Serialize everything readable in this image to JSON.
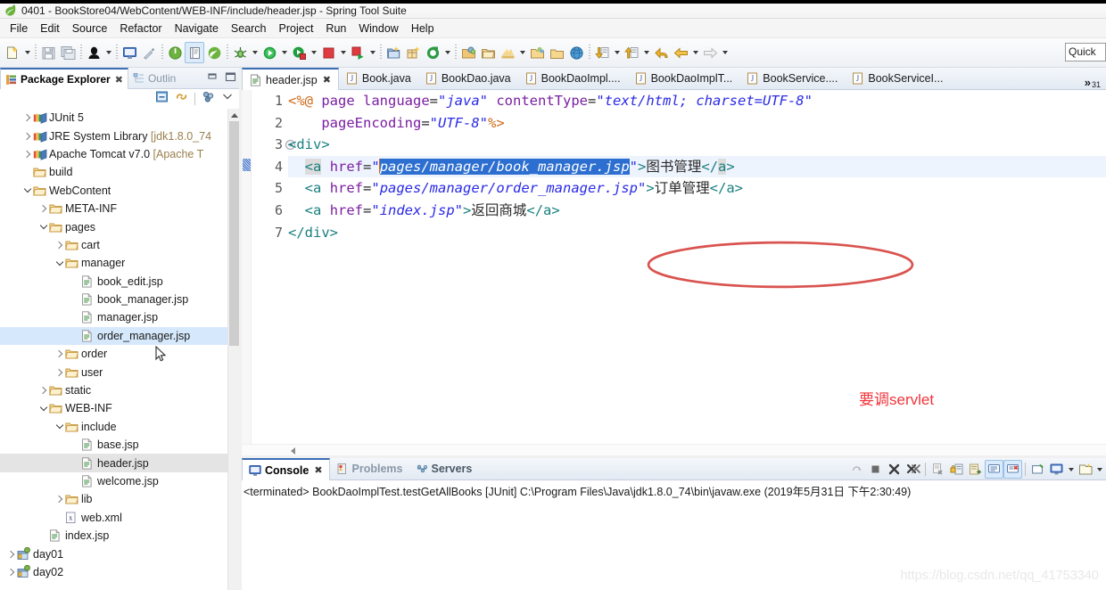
{
  "window": {
    "title": "0401 - BookStore04/WebContent/WEB-INF/include/header.jsp - Spring Tool Suite",
    "logo_icon": "spring-leaf-icon"
  },
  "menubar": {
    "items": [
      {
        "label": "File"
      },
      {
        "label": "Edit"
      },
      {
        "label": "Source"
      },
      {
        "label": "Refactor"
      },
      {
        "label": "Navigate"
      },
      {
        "label": "Search"
      },
      {
        "label": "Project"
      },
      {
        "label": "Run"
      },
      {
        "label": "Window"
      },
      {
        "label": "Help"
      }
    ]
  },
  "toolbar": {
    "quick_access_text": "Quick",
    "buttons": [
      {
        "name": "new-wizard-icon",
        "type": "icon"
      },
      {
        "name": "new-dropdown-arrow",
        "type": "arrow"
      },
      {
        "name": "separator-1",
        "type": "sep"
      },
      {
        "name": "save-icon",
        "type": "icon"
      },
      {
        "name": "save-all-icon",
        "type": "icon"
      },
      {
        "name": "separator-2",
        "type": "sep"
      },
      {
        "name": "print-icon",
        "type": "icon"
      },
      {
        "name": "print-dropdown-arrow",
        "type": "arrow"
      },
      {
        "name": "separator-3",
        "type": "sep"
      },
      {
        "name": "open-console-icon",
        "type": "icon"
      },
      {
        "name": "toggle-markoccurrences-icon",
        "type": "icon"
      },
      {
        "name": "separator-4",
        "type": "sep"
      },
      {
        "name": "boot-dashboard-icon",
        "type": "icon"
      },
      {
        "name": "new-spring-file-icon",
        "type": "icon"
      },
      {
        "name": "spring-leaf-icon",
        "type": "icon"
      },
      {
        "name": "separator-5",
        "type": "sep"
      },
      {
        "name": "debug-icon",
        "type": "icon"
      },
      {
        "name": "debug-dropdown-arrow",
        "type": "arrow"
      },
      {
        "name": "run-icon",
        "type": "icon"
      },
      {
        "name": "run-dropdown-arrow",
        "type": "arrow"
      },
      {
        "name": "run-external-icon",
        "type": "icon"
      },
      {
        "name": "run-external-dropdown-arrow",
        "type": "arrow"
      },
      {
        "name": "stop-icon",
        "type": "icon"
      },
      {
        "name": "stop-dropdown-arrow",
        "type": "arrow"
      },
      {
        "name": "run-server-icon",
        "type": "icon"
      },
      {
        "name": "run-server-dropdown-arrow",
        "type": "arrow"
      },
      {
        "name": "separator-6",
        "type": "sep"
      },
      {
        "name": "new-java-project-icon",
        "type": "icon"
      },
      {
        "name": "new-package-icon",
        "type": "icon"
      },
      {
        "name": "new-class-icon",
        "type": "icon"
      },
      {
        "name": "new-class-dropdown-arrow",
        "type": "arrow"
      },
      {
        "name": "separator-7",
        "type": "sep"
      },
      {
        "name": "open-type-icon",
        "type": "icon"
      },
      {
        "name": "open-task-icon",
        "type": "icon"
      },
      {
        "name": "search-web-icon",
        "type": "icon"
      },
      {
        "name": "search-dropdown-arrow",
        "type": "arrow"
      },
      {
        "name": "open-resource-icon",
        "type": "icon"
      },
      {
        "name": "browser-icon",
        "type": "icon"
      },
      {
        "name": "separator-8",
        "type": "sep"
      },
      {
        "name": "next-annotation-icon",
        "type": "icon"
      },
      {
        "name": "next-annotation-dropdown-arrow",
        "type": "arrow"
      },
      {
        "name": "previous-annotation-icon",
        "type": "icon"
      },
      {
        "name": "previous-annotation-dropdown-arrow",
        "type": "arrow"
      },
      {
        "name": "last-edit-location-icon",
        "type": "icon"
      },
      {
        "name": "back-icon",
        "type": "icon"
      },
      {
        "name": "back-dropdown-arrow",
        "type": "arrow"
      },
      {
        "name": "forward-icon",
        "type": "icon"
      },
      {
        "name": "forward-dropdown-arrow",
        "type": "arrow"
      }
    ]
  },
  "explorer": {
    "tabs": [
      {
        "label": "Package Explorer",
        "active": true,
        "icon": "package-explorer-icon"
      },
      {
        "label": "Outlin",
        "active": false,
        "icon": "outline-icon"
      }
    ],
    "view_controls": [
      "minimize-icon",
      "maximize-icon"
    ],
    "toolbar_icons": [
      "collapse-all-icon",
      "link-with-editor-icon",
      "view-menu-filter-icon",
      "view-menu-icon"
    ],
    "tree": [
      {
        "label": "JUnit 5",
        "icon": "library-icon",
        "indent": 1,
        "twisty": "right",
        "state": "normal"
      },
      {
        "label": "JRE System Library ",
        "dim": "[jdk1.8.0_74",
        "icon": "library-icon",
        "indent": 1,
        "twisty": "right",
        "state": "normal"
      },
      {
        "label": "Apache Tomcat v7.0 ",
        "dim": "[Apache T",
        "icon": "library-icon",
        "indent": 1,
        "twisty": "right",
        "state": "normal"
      },
      {
        "label": "build",
        "icon": "folder-icon",
        "indent": 1,
        "twisty": "none",
        "state": "normal"
      },
      {
        "label": "WebContent",
        "icon": "folder-icon",
        "indent": 1,
        "twisty": "down",
        "state": "normal"
      },
      {
        "label": "META-INF",
        "icon": "folder-icon",
        "indent": 2,
        "twisty": "right",
        "state": "normal"
      },
      {
        "label": "pages",
        "icon": "folder-icon",
        "indent": 2,
        "twisty": "down",
        "state": "normal"
      },
      {
        "label": "cart",
        "icon": "folder-icon",
        "indent": 3,
        "twisty": "right",
        "state": "normal"
      },
      {
        "label": "manager",
        "icon": "folder-icon",
        "indent": 3,
        "twisty": "down",
        "state": "normal"
      },
      {
        "label": "book_edit.jsp",
        "icon": "jsp-file-icon",
        "indent": 4,
        "twisty": "none",
        "state": "normal"
      },
      {
        "label": "book_manager.jsp",
        "icon": "jsp-file-icon",
        "indent": 4,
        "twisty": "none",
        "state": "normal"
      },
      {
        "label": "manager.jsp",
        "icon": "jsp-file-icon",
        "indent": 4,
        "twisty": "none",
        "state": "normal"
      },
      {
        "label": "order_manager.jsp",
        "icon": "jsp-file-icon",
        "indent": 4,
        "twisty": "none",
        "state": "selected-blue"
      },
      {
        "label": "order",
        "icon": "folder-icon",
        "indent": 3,
        "twisty": "right",
        "state": "normal"
      },
      {
        "label": "user",
        "icon": "folder-icon",
        "indent": 3,
        "twisty": "right",
        "state": "normal"
      },
      {
        "label": "static",
        "icon": "folder-icon",
        "indent": 2,
        "twisty": "right",
        "state": "normal"
      },
      {
        "label": "WEB-INF",
        "icon": "folder-icon",
        "indent": 2,
        "twisty": "down",
        "state": "normal"
      },
      {
        "label": "include",
        "icon": "folder-icon",
        "indent": 3,
        "twisty": "down",
        "state": "normal"
      },
      {
        "label": "base.jsp",
        "icon": "jsp-file-icon",
        "indent": 4,
        "twisty": "none",
        "state": "normal"
      },
      {
        "label": "header.jsp",
        "icon": "jsp-file-icon",
        "indent": 4,
        "twisty": "none",
        "state": "selected-gray"
      },
      {
        "label": "welcome.jsp",
        "icon": "jsp-file-icon",
        "indent": 4,
        "twisty": "none",
        "state": "normal"
      },
      {
        "label": "lib",
        "icon": "folder-icon",
        "indent": 3,
        "twisty": "right",
        "state": "normal"
      },
      {
        "label": "web.xml",
        "icon": "xml-file-icon",
        "indent": 3,
        "twisty": "none",
        "state": "normal"
      },
      {
        "label": "index.jsp",
        "icon": "jsp-file-icon",
        "indent": 2,
        "twisty": "none",
        "state": "normal"
      },
      {
        "label": "day01",
        "icon": "web-project-icon",
        "indent": 0,
        "twisty": "right",
        "state": "normal"
      },
      {
        "label": "day02",
        "icon": "web-project-icon",
        "indent": 0,
        "twisty": "right",
        "state": "normal"
      }
    ]
  },
  "editor": {
    "tabs": [
      {
        "label": "header.jsp",
        "icon": "jsp-file-icon",
        "active": true,
        "closable": true
      },
      {
        "label": "Book.java",
        "icon": "java-file-icon",
        "active": false,
        "closable": false
      },
      {
        "label": "BookDao.java",
        "icon": "java-file-icon",
        "active": false,
        "closable": false
      },
      {
        "label": "BookDaoImpl....",
        "icon": "java-file-icon",
        "active": false,
        "closable": false
      },
      {
        "label": "BookDaoImplT...",
        "icon": "java-file-icon",
        "active": false,
        "closable": false
      },
      {
        "label": "BookService....",
        "icon": "java-file-icon",
        "active": false,
        "closable": false
      },
      {
        "label": "BookServiceI...",
        "icon": "java-file-icon",
        "active": false,
        "closable": false
      }
    ],
    "overflow_chevron": "»",
    "overflow_count": "31",
    "line_numbers": [
      "1",
      "2",
      "3",
      "4",
      "5",
      "6",
      "7"
    ],
    "code_lines": [
      {
        "number": "1",
        "segments": [
          {
            "text": "<%@ ",
            "style": "dir"
          },
          {
            "text": "page",
            "style": "attr"
          },
          {
            "text": " ",
            "style": "txt"
          },
          {
            "text": "language",
            "style": "attr"
          },
          {
            "text": "=",
            "style": "eq"
          },
          {
            "text": "\"java\"",
            "style": "str"
          },
          {
            "text": " ",
            "style": "txt"
          },
          {
            "text": "contentType",
            "style": "attr"
          },
          {
            "text": "=",
            "style": "eq"
          },
          {
            "text": "\"text/html; charset=UTF-8\"",
            "style": "str"
          }
        ]
      },
      {
        "number": "2",
        "segments": [
          {
            "text": "    ",
            "style": "txt"
          },
          {
            "text": "pageEncoding",
            "style": "attr"
          },
          {
            "text": "=",
            "style": "eq"
          },
          {
            "text": "\"UTF-8\"",
            "style": "str"
          },
          {
            "text": "%>",
            "style": "dir"
          }
        ]
      },
      {
        "number": "3",
        "segments": [
          {
            "text": "<div>",
            "style": "tag"
          }
        ]
      },
      {
        "number": "4",
        "segments": [
          {
            "text": "  ",
            "style": "txt"
          },
          {
            "text": "<a",
            "style": "tagbg"
          },
          {
            "text": " ",
            "style": "txt"
          },
          {
            "text": "href",
            "style": "attr"
          },
          {
            "text": "=",
            "style": "eq"
          },
          {
            "text": "\"",
            "style": "str"
          },
          {
            "text": "pages/manager/book_manager.jsp",
            "style": "str-sel"
          },
          {
            "text": "\"",
            "style": "str"
          },
          {
            "text": ">",
            "style": "tag"
          },
          {
            "text": "图书管理",
            "style": "txt"
          },
          {
            "text": "</",
            "style": "tag"
          },
          {
            "text": "a",
            "style": "tagbg"
          },
          {
            "text": ">",
            "style": "tag"
          }
        ]
      },
      {
        "number": "5",
        "segments": [
          {
            "text": "  ",
            "style": "txt"
          },
          {
            "text": "<a",
            "style": "tag"
          },
          {
            "text": " ",
            "style": "txt"
          },
          {
            "text": "href",
            "style": "attr"
          },
          {
            "text": "=",
            "style": "eq"
          },
          {
            "text": "\"pages/manager/order_manager.jsp\"",
            "style": "str"
          },
          {
            "text": ">",
            "style": "tag"
          },
          {
            "text": "订单管理",
            "style": "txt"
          },
          {
            "text": "</a>",
            "style": "tag"
          }
        ]
      },
      {
        "number": "6",
        "segments": [
          {
            "text": "  ",
            "style": "txt"
          },
          {
            "text": "<a",
            "style": "tag"
          },
          {
            "text": " ",
            "style": "txt"
          },
          {
            "text": "href",
            "style": "attr"
          },
          {
            "text": "=",
            "style": "eq"
          },
          {
            "text": "\"index.jsp\"",
            "style": "str"
          },
          {
            "text": ">",
            "style": "tag"
          },
          {
            "text": "返回商城",
            "style": "txt"
          },
          {
            "text": "</a>",
            "style": "tag"
          }
        ]
      },
      {
        "number": "7",
        "segments": [
          {
            "text": "</div>",
            "style": "tag"
          }
        ]
      }
    ],
    "annotations": {
      "note_text": "要调servlet",
      "note_color": "#f0353a",
      "ellipse_color": "#d9534f"
    }
  },
  "console": {
    "tabs": [
      {
        "label": "Console",
        "active": true,
        "icon": "console-icon",
        "closable": true
      },
      {
        "label": "Problems",
        "active": false,
        "icon": "problems-icon",
        "closable": false
      },
      {
        "label": "Servers",
        "active": false,
        "icon": "servers-icon",
        "closable": false
      }
    ],
    "toolbar_icons": [
      "relaunch-icon",
      "terminate-icon",
      "remove-launch-icon",
      "remove-all-terminated-icon",
      "separator",
      "clear-console-icon",
      "scroll-lock-icon",
      "word-wrap-icon",
      "show-console-on-output-icon",
      "show-console-on-error-icon",
      "separator",
      "pin-console-icon",
      "display-selected-console-icon",
      "display-selected-console-arrow",
      "open-console-icon",
      "open-console-arrow"
    ],
    "output_line": "<terminated> BookDaoImplTest.testGetAllBooks [JUnit] C:\\Program Files\\Java\\jdk1.8.0_74\\bin\\javaw.exe (2019年5月31日 下午2:30:49)"
  },
  "watermark": {
    "text": "https://blog.csdn.net/qq_41753340"
  }
}
